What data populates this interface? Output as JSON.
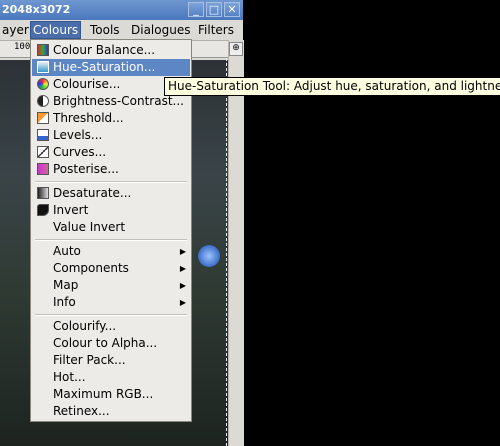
{
  "window": {
    "title": "2048x3072"
  },
  "menubar": [
    "ayer",
    "Colours",
    "Tools",
    "Dialogues",
    "Filters"
  ],
  "ruler_labels": [
    "100"
  ],
  "menu": {
    "group1": [
      {
        "label": "Colour Balance...",
        "icon": "colour-balance-icon"
      },
      {
        "label": "Hue-Saturation...",
        "icon": "hue-saturation-icon",
        "highlighted": true
      },
      {
        "label": "Colourise...",
        "icon": "colourise-icon"
      },
      {
        "label": "Brightness-Contrast...",
        "icon": "brightness-contrast-icon"
      },
      {
        "label": "Threshold...",
        "icon": "threshold-icon"
      },
      {
        "label": "Levels...",
        "icon": "levels-icon"
      },
      {
        "label": "Curves...",
        "icon": "curves-icon"
      },
      {
        "label": "Posterise...",
        "icon": "posterise-icon"
      }
    ],
    "group2": [
      {
        "label": "Desaturate...",
        "icon": "desaturate-icon"
      },
      {
        "label": "Invert",
        "icon": "invert-icon"
      },
      {
        "label": "Value Invert"
      }
    ],
    "group3": [
      "Auto",
      "Components",
      "Map",
      "Info"
    ],
    "group4": [
      "Colourify...",
      "Colour to Alpha...",
      "Filter Pack...",
      "Hot...",
      "Maximum RGB...",
      "Retinex..."
    ]
  },
  "tooltip": "Hue-Saturation Tool: Adjust hue, saturation, and lightness",
  "colors": {
    "highlight": "#5d86c4",
    "titlebar": "#4a78bd",
    "menu_bg": "#edebe8"
  }
}
